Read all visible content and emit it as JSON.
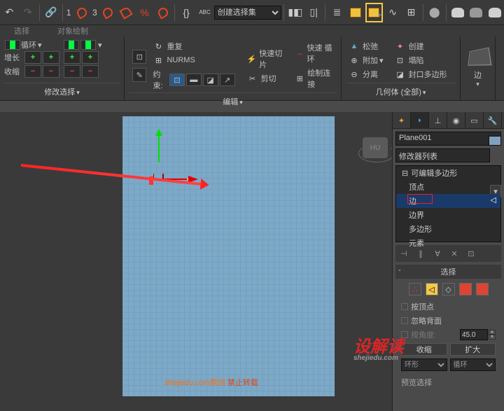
{
  "toolbar": {
    "num1": "1",
    "num2": "3",
    "abc": "ABC",
    "select_set": "创建选择集",
    "select_set_placeholder": "创建选择集"
  },
  "tabs": {
    "t1": "选择",
    "t2": "对象绘制"
  },
  "ribbon": {
    "panel1": {
      "loop": "循环",
      "grow": "增长",
      "shrink": "收缩",
      "title": "修改选择"
    },
    "panel2": {
      "repeat": "重复",
      "nurms": "NURMS",
      "constrain": "约束:",
      "quickslice": "快速切片",
      "cut": "剪切",
      "quickloop": "快速 循环",
      "paintconnect": "绘制连接",
      "title": "编辑"
    },
    "panel3": {
      "relax": "松弛",
      "attach": "附加",
      "detach": "分离",
      "create": "创建",
      "collapse": "塌陷",
      "cap": "封口多边形",
      "title": "几何体 (全部)"
    },
    "edge_btn": "边"
  },
  "viewport": {
    "cube": "HU",
    "watermark_site": "shejiedu.com原创",
    "watermark_ban": "禁止转载",
    "big_wm": "设解读",
    "big_wm_sub": "shejiedu.com"
  },
  "cmd": {
    "obj_name": "Plane001",
    "mod_list": "修改器列表",
    "stack": {
      "root": "可编辑多边形",
      "vertex": "顶点",
      "edge": "边",
      "border": "边界",
      "polygon": "多边形",
      "element": "元素"
    },
    "selection": {
      "title": "选择",
      "by_vertex": "按顶点",
      "ignore_backface": "忽略背面",
      "angle_val": "45.0",
      "preview": "预览选择",
      "shrink": "收缩",
      "grow": "扩大",
      "ring": "环形",
      "loop": "循环"
    }
  }
}
